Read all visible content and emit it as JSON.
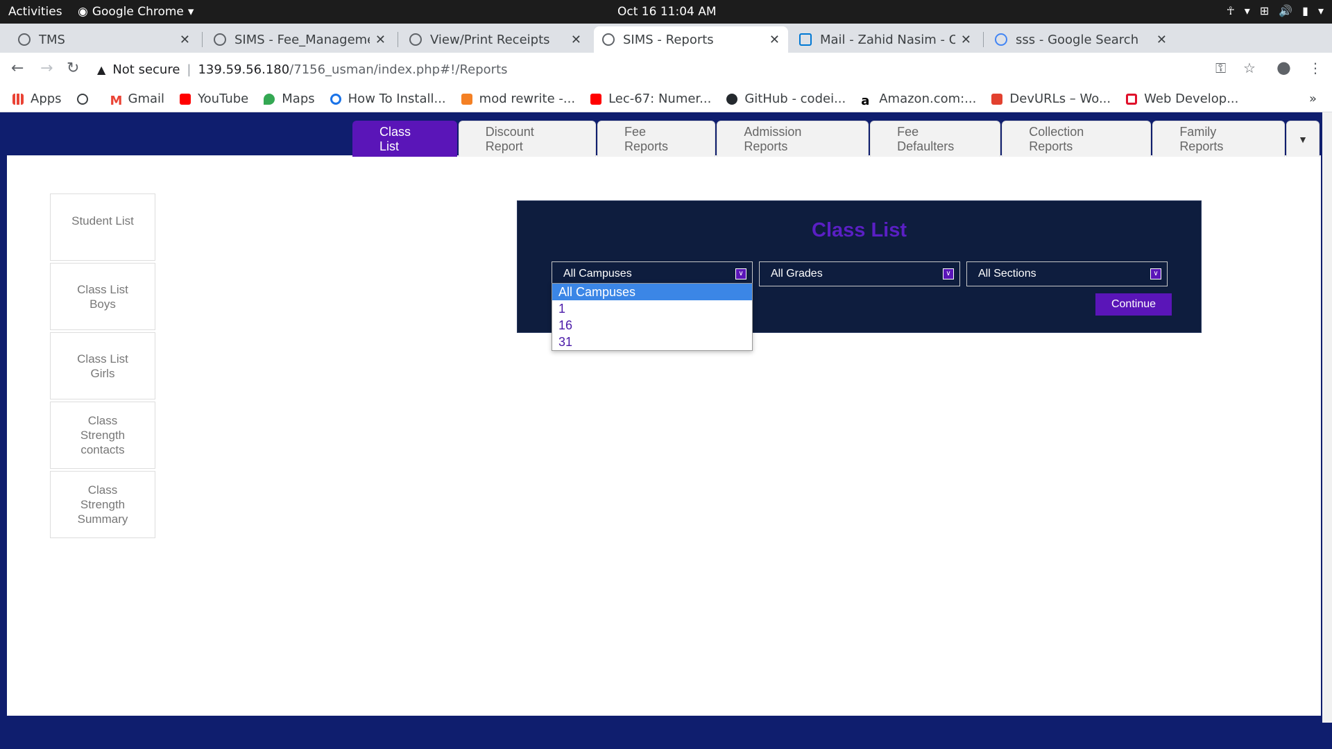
{
  "system_bar": {
    "activities": "Activities",
    "app_name": "Google Chrome",
    "clock": "Oct 16  11:04 AM"
  },
  "tabs": [
    {
      "title": "TMS"
    },
    {
      "title": "SIMS - Fee_Managemen"
    },
    {
      "title": "View/Print Receipts"
    },
    {
      "title": "SIMS - Reports"
    },
    {
      "title": "Mail - Zahid Nasim - Out"
    },
    {
      "title": "sss - Google Search"
    }
  ],
  "address_bar": {
    "security": "Not secure",
    "host": "139.59.56.180",
    "path": "/7156_usman/index.php#!/Reports"
  },
  "bookmarks": [
    {
      "label": "Apps",
      "color": "#ea4335"
    },
    {
      "label": "",
      "color": "#3c4043"
    },
    {
      "label": "Gmail",
      "color": "#ea4335"
    },
    {
      "label": "YouTube",
      "color": "#ff0000"
    },
    {
      "label": "Maps",
      "color": "#34a853"
    },
    {
      "label": "How To Install...",
      "color": "#1a73e8"
    },
    {
      "label": "mod rewrite -...",
      "color": "#f48024"
    },
    {
      "label": "Lec-67: Numer...",
      "color": "#ff0000"
    },
    {
      "label": "GitHub - codei...",
      "color": "#24292e"
    },
    {
      "label": "Amazon.com:...",
      "color": "#000000"
    },
    {
      "label": "DevURLs – Wo...",
      "color": "#e2412f"
    },
    {
      "label": "Web Develop...",
      "color": "#e0102b"
    }
  ],
  "bookmarks_more": "»",
  "report_tabs": [
    {
      "label": "Class List"
    },
    {
      "label": "Discount Report"
    },
    {
      "label": "Fee Reports"
    },
    {
      "label": "Admission Reports"
    },
    {
      "label": "Fee Defaulters"
    },
    {
      "label": "Collection Reports"
    },
    {
      "label": "Family Reports"
    }
  ],
  "side_menu": [
    {
      "label": "Student List"
    },
    {
      "label": "Class List Boys"
    },
    {
      "label": "Class List Girls"
    },
    {
      "label": "Class Strength contacts"
    },
    {
      "label": "Class Strength Summary"
    }
  ],
  "panel": {
    "title": "Class List",
    "campus_value": "All Campuses",
    "grade_value": "All Grades",
    "section_value": "All Sections",
    "continue_label": "Continue"
  },
  "campus_options": [
    "All Campuses",
    "1",
    "16",
    "31"
  ],
  "colors": {
    "page_bg": "#0f1e6e",
    "accent": "#5a15b8",
    "panel_bg": "#0e1d3e",
    "selected_option": "#3b86e6"
  }
}
